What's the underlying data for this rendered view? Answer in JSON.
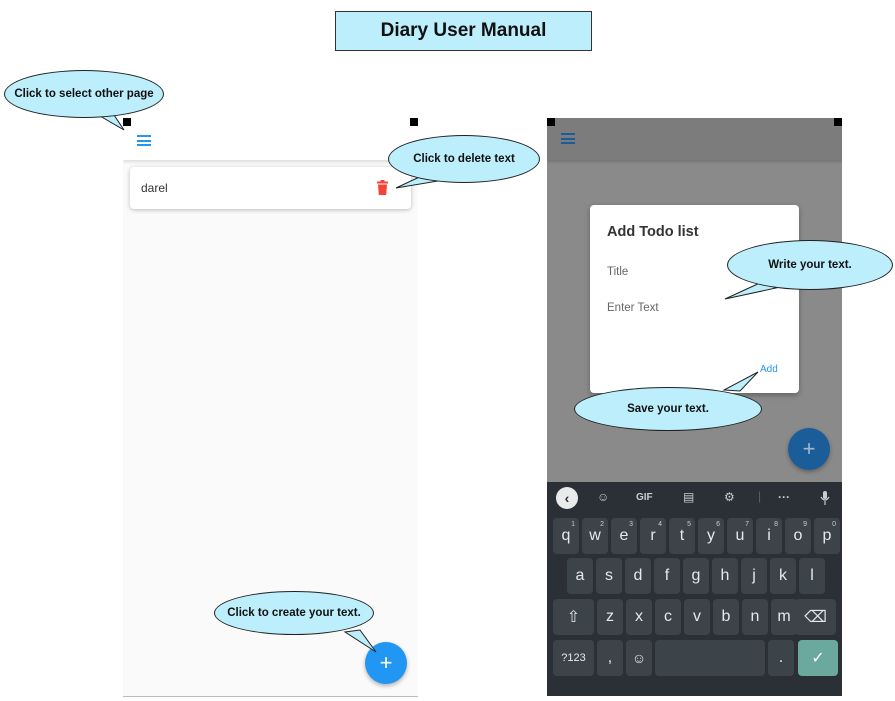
{
  "manual": {
    "title": "Diary User Manual"
  },
  "callouts": {
    "select_page": "Click to select other page",
    "delete": "Click to delete text",
    "create": "Click to create your text.",
    "write": "Write your text.",
    "save": "Save your text."
  },
  "left_screen": {
    "notes": [
      {
        "text": "darel"
      }
    ],
    "fab_label": "+"
  },
  "right_screen": {
    "dialog": {
      "title": "Add Todo list",
      "title_placeholder": "Title",
      "text_placeholder": "Enter Text",
      "add_label": "Add"
    },
    "fab_label": "+",
    "keyboard": {
      "toolbar": {
        "gif": "GIF",
        "more": "···"
      },
      "row1": [
        "q",
        "w",
        "e",
        "r",
        "t",
        "y",
        "u",
        "i",
        "o",
        "p"
      ],
      "row1_hints": [
        "1",
        "2",
        "3",
        "4",
        "5",
        "6",
        "7",
        "8",
        "9",
        "0"
      ],
      "row2": [
        "a",
        "s",
        "d",
        "f",
        "g",
        "h",
        "j",
        "k",
        "l"
      ],
      "row3": [
        "z",
        "x",
        "c",
        "v",
        "b",
        "n",
        "m"
      ],
      "symbols_key": "?123",
      "comma_key": ",",
      "period_key": "."
    }
  },
  "colors": {
    "callout_fill": "#bdeefc",
    "accent": "#2196f3",
    "delete": "#f44336",
    "enter_key": "#6ba89d"
  }
}
